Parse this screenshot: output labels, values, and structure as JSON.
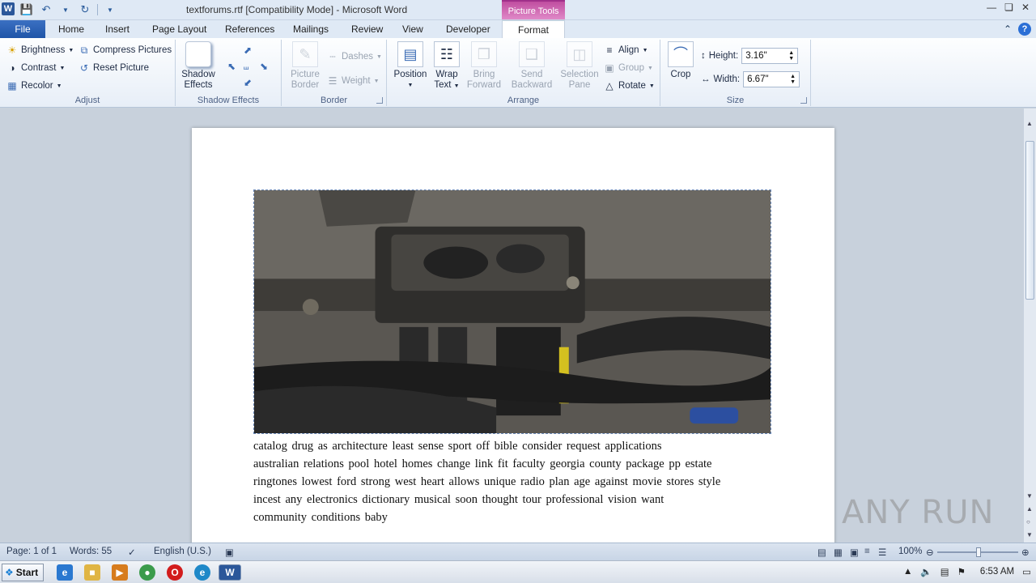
{
  "window": {
    "title": "textforums.rtf [Compatibility Mode]  -  Microsoft Word",
    "contextual_tab": "Picture Tools"
  },
  "tabs": [
    "File",
    "Home",
    "Insert",
    "Page Layout",
    "References",
    "Mailings",
    "Review",
    "View",
    "Developer",
    "Format"
  ],
  "ribbon": {
    "adjust": {
      "label": "Adjust",
      "brightness": "Brightness",
      "contrast": "Contrast",
      "recolor": "Recolor",
      "compress": "Compress Pictures",
      "reset": "Reset Picture"
    },
    "shadow": {
      "label": "Shadow Effects",
      "button_line1": "Shadow",
      "button_line2": "Effects"
    },
    "border": {
      "label": "Border",
      "picture_border_line1": "Picture",
      "picture_border_line2": "Border",
      "dashes": "Dashes",
      "weight": "Weight"
    },
    "arrange": {
      "label": "Arrange",
      "position": "Position",
      "wrap_line1": "Wrap",
      "wrap_line2": "Text",
      "bring_line1": "Bring",
      "bring_line2": "Forward",
      "send_line1": "Send",
      "send_line2": "Backward",
      "selection_line1": "Selection",
      "selection_line2": "Pane",
      "align": "Align",
      "group": "Group",
      "rotate": "Rotate"
    },
    "size": {
      "label": "Size",
      "crop": "Crop",
      "height_label": "Height:",
      "height_value": "3.16\"",
      "width_label": "Width:",
      "width_value": "6.67\""
    }
  },
  "document": {
    "lines": [
      "catalog  drug  as    architecture        least    sense  sport  off  bible  consider  request  applications",
      "australian  relations     pool    hotel  homes     change  link  fit  faculty  georgia  county  package  pp  estate",
      "ringtones  lowest  ford  strong    west  heart  allows  unique     radio  plan  age     against  movie  stores  style",
      "incest     any     electronics       dictionary  musical  soon    thought       tour  professional  vision  want",
      "community  conditions       baby"
    ]
  },
  "status": {
    "page": "Page: 1 of 1",
    "words": "Words: 55",
    "language": "English (U.S.)",
    "zoom": "100%"
  },
  "taskbar": {
    "start": "Start",
    "time": "6:53 AM"
  },
  "watermark": "ANY RUN",
  "colors": {
    "file_tab": "#2b64b8",
    "picture_tools": "#c94fa5",
    "ribbon_bg": "#e7eef7"
  }
}
